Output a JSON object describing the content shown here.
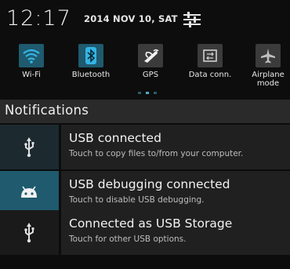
{
  "status": {
    "time": "12:17",
    "date": "2014 NOV 10, SAT"
  },
  "toggles": [
    {
      "label": "Wi-Fi",
      "icon": "wifi-icon",
      "on": true
    },
    {
      "label": "Bluetooth",
      "icon": "bluetooth-icon",
      "on": true
    },
    {
      "label": "GPS",
      "icon": "gps-icon",
      "on": false
    },
    {
      "label": "Data conn.",
      "icon": "data-connection-icon",
      "on": false
    },
    {
      "label": "Airplane mode",
      "icon": "airplane-icon",
      "on": false
    }
  ],
  "notifications_header": "Notifications",
  "notifications": [
    {
      "title": "USB connected",
      "subtitle": "Touch to copy files to/from your computer.",
      "icon": "usb-icon"
    },
    {
      "title": "USB debugging connected",
      "subtitle": "Touch to disable USB debugging.",
      "icon": "android-debug-icon"
    },
    {
      "title": "Connected as USB Storage",
      "subtitle": "Touch for other USB options.",
      "icon": "usb-icon"
    }
  ],
  "colors": {
    "accent": "#33b5e5",
    "active_tile": "#1f5a6e",
    "inactive_tile": "#3b3b3b",
    "background": "#0d0d0d"
  }
}
